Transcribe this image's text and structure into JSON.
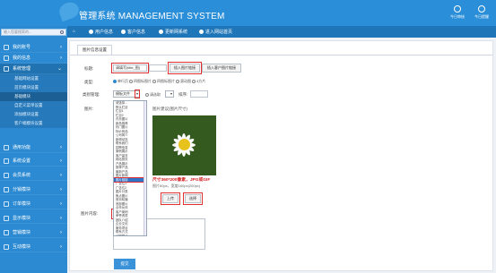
{
  "app": {
    "title": "管理系统 MANAGEMENT SYSTEM",
    "top_right": [
      {
        "label": "今日审核",
        "icon": "person-icon"
      },
      {
        "label": "今日提醒",
        "icon": "bell-icon"
      }
    ]
  },
  "nav": {
    "home_icon": "home-icon",
    "items": [
      "用户信息",
      "客户信息",
      "更新网系统",
      "进入网站首页"
    ]
  },
  "sidebar": {
    "search_placeholder": "输入您要搜索的...",
    "groups": [
      {
        "label": "我的账号",
        "icon": "user-icon"
      },
      {
        "label": "我的信息",
        "icon": "info-icon"
      },
      {
        "label": "系统管理",
        "icon": "gear-icon",
        "active": true
      }
    ],
    "sub_items": [
      "基础网站设置",
      "首页模块设置",
      "基础模块",
      "自定义菜单设置",
      "添加模块设置",
      "客户端模块设置"
    ],
    "current_sub": 2,
    "groups_after": [
      {
        "label": "通用功能"
      },
      {
        "label": "系统设置"
      },
      {
        "label": "会员系统"
      },
      {
        "label": "分销模块"
      },
      {
        "label": "订单模块"
      },
      {
        "label": "显示模块"
      },
      {
        "label": "营销模块"
      },
      {
        "label": "互动模块"
      }
    ]
  },
  "form": {
    "tab": "图片信息设置",
    "title_label": "标题:",
    "title_value": "请填写(title_图)",
    "title_btn1": "插入图片链接",
    "title_btn2": "插入客户图片链接",
    "type_label": "类型:",
    "type_options": [
      {
        "label": "单行页",
        "checked": true
      },
      {
        "label": "四图标图片",
        "checked": false
      },
      {
        "label": "四图标图片",
        "checked": false
      },
      {
        "label": "滚动图",
        "checked": false
      },
      {
        "label": "4方片",
        "checked": false
      }
    ],
    "category_label": "类别管理:",
    "category_value": "模板文件",
    "category_small_label": "请选取",
    "sort_label": "排序:",
    "sort_value": "",
    "image_label": "图片:",
    "image_hint": "图片建议(图片尺寸)",
    "image_note": "尺寸360*200像素，JPG或GIF",
    "image_caption": "图片60px，宽度160px(200px)",
    "upload_btn": "上传",
    "browse_btn": "选择",
    "link_label": "图片内容:",
    "link_value": "2222",
    "submit": "提交"
  },
  "dropdown": {
    "items": [
      "请选择...",
      "默认栏目",
      "栏目1",
      "栏目2",
      "内页图片",
      "新品推荐",
      "热门图片",
      "特价商品",
      "公司简介",
      "新闻动态",
      "联系我们",
      "招聘信息",
      "案例展示",
      "客户留言",
      "网站首页",
      "产品展示",
      "推荐产品",
      "最新产品",
      "图片新闻",
      "图片链接",
      "广告位1",
      "广告位2",
      "图片分类",
      "焦点图片",
      "首页轮播",
      "底部图片",
      "合作伙伴",
      "客户案例",
      "荣誉资质",
      "团队介绍",
      "企业文化",
      "服务项目",
      "联系方式",
      "地图展示",
      "下载中心"
    ],
    "highlight_index": 19
  },
  "colors": {
    "brand": "#2a8ed8",
    "accent_red": "#e23030",
    "submit": "#3a92d9"
  }
}
